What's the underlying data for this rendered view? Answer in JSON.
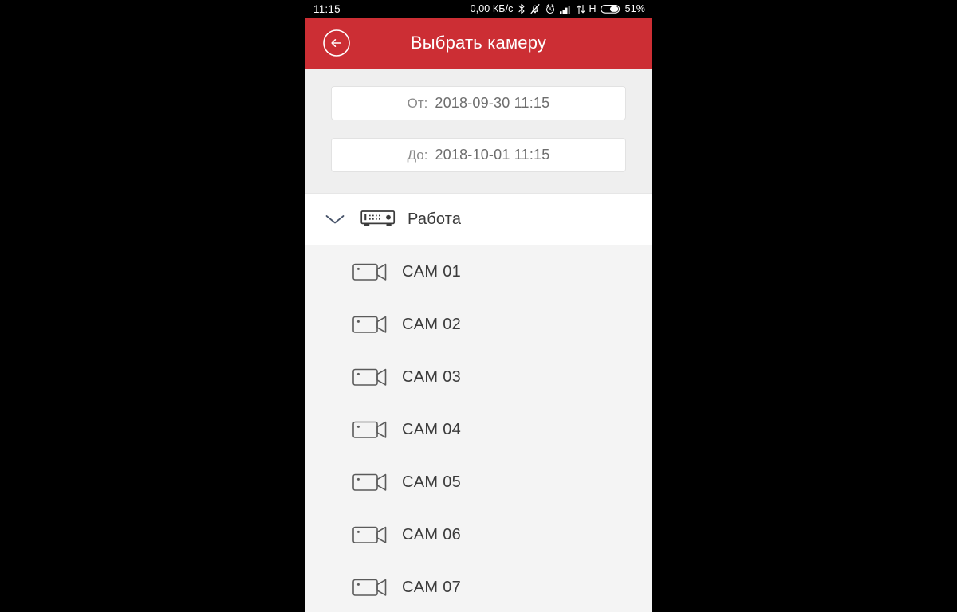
{
  "status_bar": {
    "clock": "11:15",
    "data_rate": "0,00 КБ/с",
    "network_type": "H",
    "battery_percent": "51%",
    "icons": [
      "bluetooth-icon",
      "vibrate-muted-icon",
      "alarm-clock-icon",
      "signal-bars-icon",
      "data-transfer-icon",
      "battery-icon"
    ]
  },
  "app_bar": {
    "title": "Выбрать камеру",
    "back_icon": "back-arrow-circle-icon",
    "background_color": "#cc2e34"
  },
  "range_panel": {
    "from": {
      "label": "От:",
      "value": "2018-09-30 11:15"
    },
    "to": {
      "label": "До:",
      "value": "2018-10-01 11:15"
    }
  },
  "group": {
    "label": "Работа",
    "expanded": true,
    "chevron_icon": "chevron-down-icon",
    "device_icon": "dvr-device-icon"
  },
  "cameras": [
    {
      "label": "CAM 01",
      "icon": "video-camera-icon"
    },
    {
      "label": "CAM 02",
      "icon": "video-camera-icon"
    },
    {
      "label": "CAM 03",
      "icon": "video-camera-icon"
    },
    {
      "label": "CAM 04",
      "icon": "video-camera-icon"
    },
    {
      "label": "CAM 05",
      "icon": "video-camera-icon"
    },
    {
      "label": "CAM 06",
      "icon": "video-camera-icon"
    },
    {
      "label": "CAM 07",
      "icon": "video-camera-icon"
    }
  ],
  "colors": {
    "accent_red": "#cc2e34",
    "panel_grey": "#efefef",
    "list_grey": "#f4f4f4",
    "text_dark": "#3b3b3b",
    "text_muted": "#8b8b8b"
  }
}
